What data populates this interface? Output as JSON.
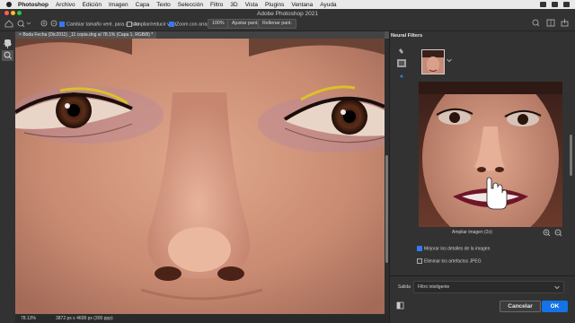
{
  "menu": {
    "app": "Photoshop",
    "items": [
      "Archivo",
      "Edición",
      "Imagen",
      "Capa",
      "Texto",
      "Selección",
      "Filtro",
      "3D",
      "Vista",
      "Plugins",
      "Ventana",
      "Ayuda"
    ]
  },
  "window": {
    "title": "Adobe Photoshop 2021"
  },
  "options": {
    "resize_windows": "Cambiar tamaño vent. para ajustar",
    "zoom_all_windows": "Ampliar/reducir vent.",
    "scrubby_zoom": "Zoom con arrastre",
    "zoom_value": "100%",
    "fit_screen": "Ajustar pant.",
    "fill_screen": "Rellenar pant."
  },
  "document": {
    "tab_label": "Boda Fecha (Dic2011) _11 copia.dng al 78.1% (Capa 1, RGB/8) *",
    "zoom": "78.13%",
    "dimensions": "3872 px x 4608 px (300 ppp)"
  },
  "panel": {
    "title": "Neural Filters",
    "zoom_label": "Ampliar imagen (2x)",
    "options": [
      {
        "label": "Mejorar los detalles de la imagen",
        "checked": true
      },
      {
        "label": "Eliminar los artefactos JPEG",
        "checked": false
      }
    ],
    "output_label": "Salida",
    "output_value": "Filtro inteligente",
    "cancel_label": "Cancelar",
    "ok_label": "OK"
  },
  "colors": {
    "accent": "#1473e6",
    "panel_bg": "#323232",
    "ui_dark": "#2a2a2a"
  }
}
